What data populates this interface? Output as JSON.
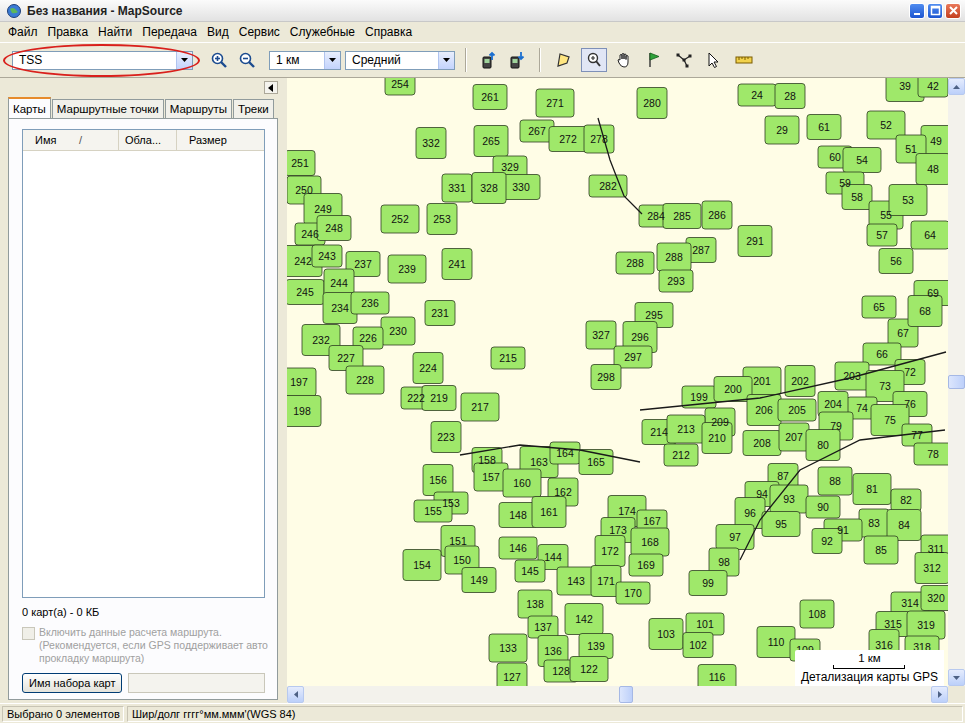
{
  "window": {
    "title": "Без названия - MapSource"
  },
  "menu": [
    "Файл",
    "Правка",
    "Найти",
    "Передача",
    "Вид",
    "Сервис",
    "Служебные",
    "Справка"
  ],
  "toolbar": {
    "items": [
      {
        "kind": "product-combo",
        "value": "TSS",
        "highlighted": true
      },
      {
        "kind": "zoom-in"
      },
      {
        "kind": "zoom-out"
      },
      {
        "kind": "scale-combo",
        "value": "1 км"
      },
      {
        "kind": "detail-combo",
        "value": "Средний"
      },
      {
        "kind": "separator"
      },
      {
        "kind": "send"
      },
      {
        "kind": "receive"
      },
      {
        "kind": "separator"
      }
    ],
    "tools": [
      {
        "kind": "map-select",
        "selected": false
      },
      {
        "kind": "zoom-tool",
        "selected": true
      },
      {
        "kind": "hand",
        "selected": false
      },
      {
        "kind": "waypoint",
        "selected": false
      },
      {
        "kind": "route",
        "selected": false
      },
      {
        "kind": "select",
        "selected": false
      },
      {
        "kind": "measure",
        "selected": false
      }
    ]
  },
  "tabs": [
    {
      "label": "Карты",
      "selected": true
    },
    {
      "label": "Маршрутные точки",
      "selected": false
    },
    {
      "label": "Маршруты",
      "selected": false
    },
    {
      "label": "Треки",
      "selected": false
    }
  ],
  "table": {
    "columns": [
      "Имя",
      "Обла...",
      "Размер"
    ],
    "sort_mark": "/"
  },
  "summary": "0 карт(а) - 0 КБ",
  "route_option": {
    "lines": [
      "Включить данные расчета маршрута.",
      "(Рекомендуется, если GPS поддерживает авто",
      "прокладку маршрута)"
    ],
    "checked": false,
    "disabled": true
  },
  "map_set_button": "Имя набора карт",
  "map": {
    "parcels": [
      "254",
      "261",
      "271",
      "280",
      "267",
      "272",
      "278",
      "265",
      "24",
      "28",
      "29",
      "39",
      "42",
      "61",
      "52",
      "49",
      "60",
      "54",
      "51",
      "48",
      "59",
      "58",
      "55",
      "53",
      "57",
      "56",
      "64",
      "332",
      "329",
      "330",
      "331",
      "328",
      "282",
      "251",
      "250",
      "249",
      "246",
      "248",
      "252",
      "253",
      "284",
      "285",
      "286",
      "291",
      "288",
      "287",
      "288",
      "242",
      "243",
      "237",
      "239",
      "241",
      "293",
      "245",
      "244",
      "234",
      "236",
      "231",
      "230",
      "232",
      "226",
      "227",
      "228",
      "224",
      "215",
      "295",
      "327",
      "296",
      "297",
      "298",
      "197",
      "198",
      "222",
      "219",
      "217",
      "223",
      "65",
      "69",
      "67",
      "68",
      "66",
      "72",
      "203",
      "73",
      "74",
      "76",
      "201",
      "202",
      "199",
      "200",
      "209",
      "206",
      "205",
      "204",
      "79",
      "75",
      "77",
      "214",
      "213",
      "210",
      "212",
      "208",
      "207",
      "80",
      "78",
      "158",
      "157",
      "163",
      "164",
      "165",
      "160",
      "156",
      "153",
      "148",
      "162",
      "161",
      "155",
      "87",
      "88",
      "81",
      "82",
      "94",
      "93",
      "96",
      "90",
      "95",
      "83",
      "84",
      "91",
      "92",
      "85",
      "174",
      "167",
      "173",
      "168",
      "172",
      "169",
      "97",
      "98",
      "151",
      "146",
      "144",
      "150",
      "154",
      "145",
      "149",
      "143",
      "171",
      "170",
      "99",
      "311",
      "312",
      "314",
      "320",
      "138",
      "142",
      "137",
      "139",
      "133",
      "136",
      "128",
      "122",
      "127",
      "103",
      "101",
      "102",
      "108",
      "110",
      "109",
      "315",
      "319",
      "316",
      "318",
      "116"
    ],
    "scale": "1 км",
    "detail_label": "Детализация карты GPS",
    "scroll": {
      "horizontal": 0.5,
      "vertical": 0.5
    }
  },
  "status_bar": [
    "Выбрано 0 элементов",
    "Шир/долг гггг°мм.ммм'(WGS 84)"
  ]
}
